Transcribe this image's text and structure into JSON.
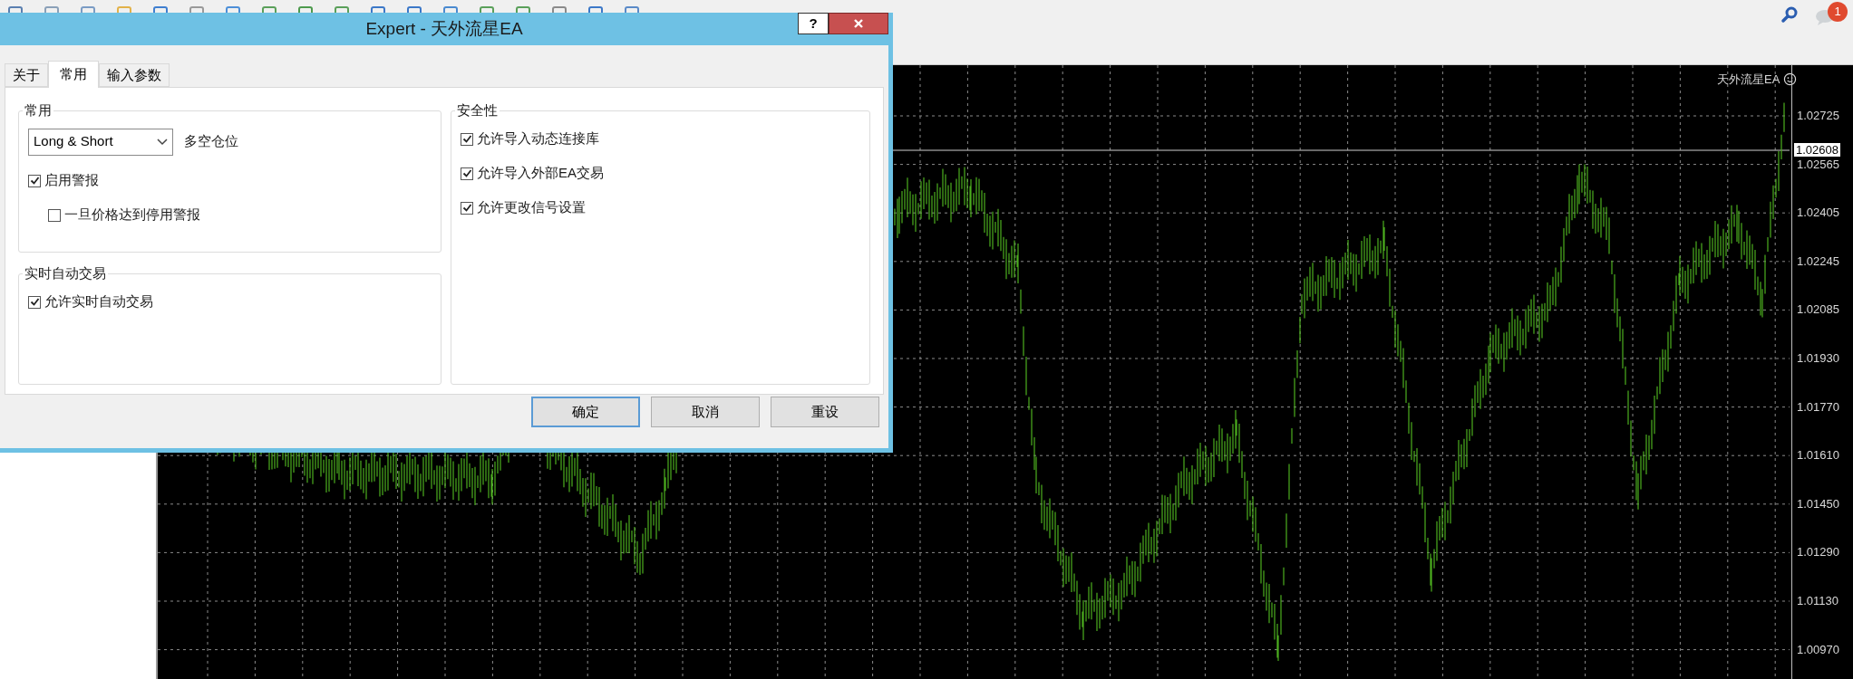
{
  "toolbar": {
    "notification_count": "1"
  },
  "chart": {
    "label": "天外流星EA",
    "current_price": "1.02608",
    "price_labels": [
      "1.02725",
      "1.02565",
      "1.02405",
      "1.02245",
      "1.02085",
      "1.01930",
      "1.01770",
      "1.01610",
      "1.01450",
      "1.01290",
      "1.01130",
      "1.00970"
    ]
  },
  "dialog": {
    "title": "Expert - 天外流星EA",
    "help": "?",
    "tabs": [
      {
        "label": "关于",
        "selected": false
      },
      {
        "label": "常用",
        "selected": true
      },
      {
        "label": "输入参数",
        "selected": false
      }
    ],
    "columns": [
      [
        {
          "title": "常用",
          "dropdown": {
            "value": "Long & Short",
            "label": "多空仓位"
          },
          "options": [
            {
              "label": "启用警报",
              "checked": true,
              "children": [
                {
                  "label": "一旦价格达到停用警报",
                  "checked": false
                }
              ]
            }
          ]
        },
        {
          "title": "实时自动交易",
          "options": [
            {
              "label": "允许实时自动交易",
              "checked": true
            }
          ]
        }
      ],
      [
        {
          "title": "安全性",
          "options": [
            {
              "label": "允许导入动态连接库",
              "checked": true
            },
            {
              "label": "允许导入外部EA交易",
              "checked": true
            },
            {
              "label": "允许更改信号设置",
              "checked": true
            }
          ]
        }
      ]
    ],
    "buttons": [
      {
        "label": "确定",
        "default": true
      },
      {
        "label": "取消",
        "default": false
      },
      {
        "label": "重设",
        "default": false
      }
    ]
  }
}
